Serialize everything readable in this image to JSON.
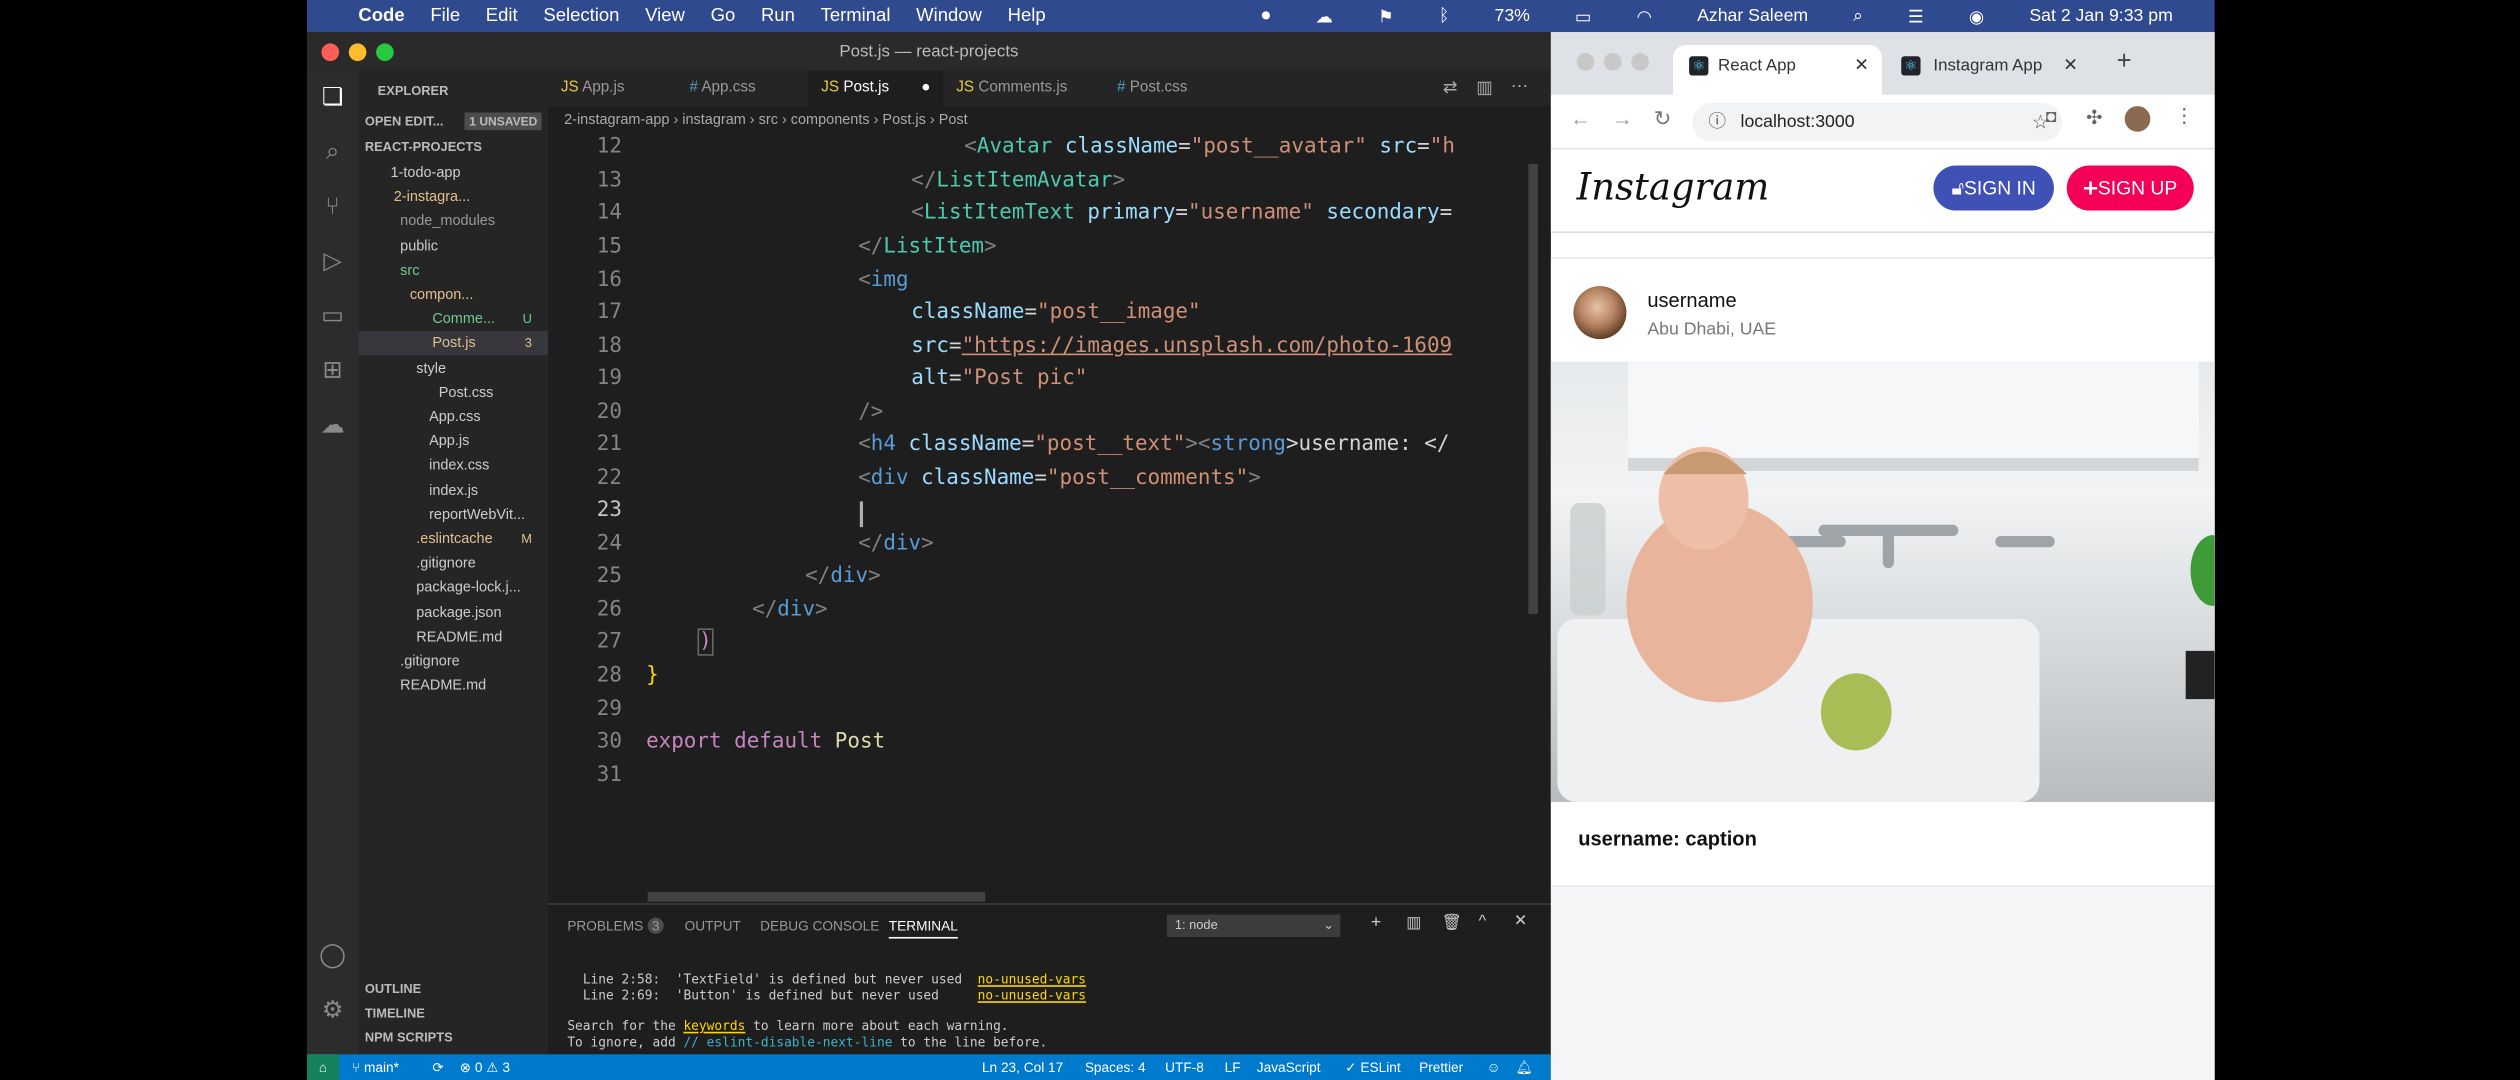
{
  "menubar": {
    "app": "Code",
    "items": [
      "File",
      "Edit",
      "Selection",
      "View",
      "Go",
      "Run",
      "Terminal",
      "Window",
      "Help"
    ],
    "battery": "73%",
    "user": "Azhar Saleem",
    "clock": "Sat 2 Jan  9:33 pm"
  },
  "vscode": {
    "title": "Post.js — react-projects",
    "tabs": [
      "App.js",
      "App.css",
      "Post.js",
      "Comments.js",
      "Post.css"
    ],
    "breadcrumb": "2-instagram-app › instagram › src › components › Post.js › Post",
    "explorer": {
      "header": "EXPLORER",
      "open_editors": "OPEN EDIT...",
      "unsaved": "1 UNSAVED",
      "project": "REACT-PROJECTS",
      "tree": [
        {
          "label": "1-todo-app",
          "badge": ""
        },
        {
          "label": "2-instagra...",
          "badge": ""
        },
        {
          "label": "node_modules",
          "badge": ""
        },
        {
          "label": "public",
          "badge": ""
        },
        {
          "label": "src",
          "badge": ""
        },
        {
          "label": "compon...",
          "badge": ""
        },
        {
          "label": "Comme...",
          "badge": "U"
        },
        {
          "label": "Post.js",
          "badge": "3"
        },
        {
          "label": "style",
          "badge": ""
        },
        {
          "label": "Post.css",
          "badge": ""
        },
        {
          "label": "App.css",
          "badge": ""
        },
        {
          "label": "App.js",
          "badge": ""
        },
        {
          "label": "index.css",
          "badge": ""
        },
        {
          "label": "index.js",
          "badge": ""
        },
        {
          "label": "reportWebVit...",
          "badge": ""
        },
        {
          "label": ".eslintcache",
          "badge": "M"
        },
        {
          "label": ".gitignore",
          "badge": ""
        },
        {
          "label": "package-lock.j...",
          "badge": ""
        },
        {
          "label": "package.json",
          "badge": ""
        },
        {
          "label": "README.md",
          "badge": ""
        },
        {
          "label": ".gitignore",
          "badge": ""
        },
        {
          "label": "README.md",
          "badge": ""
        }
      ],
      "outline": "OUTLINE",
      "timeline": "TIMELINE",
      "npm": "NPM SCRIPTS"
    },
    "line_numbers": [
      "12",
      "13",
      "14",
      "15",
      "16",
      "17",
      "18",
      "19",
      "20",
      "21",
      "22",
      "23",
      "24",
      "25",
      "26",
      "27",
      "28",
      "29",
      "30",
      "31"
    ],
    "code": {
      "l12a": "<",
      "l12b": "Avatar",
      "l12c": " className",
      "l12d": "=",
      "l12e": "\"post__avatar\"",
      "l12f": " src",
      "l12g": "=",
      "l12h": "\"h",
      "l13a": "</",
      "l13b": "ListItemAvatar",
      "l13c": ">",
      "l14a": "<",
      "l14b": "ListItemText",
      "l14c": " primary",
      "l14d": "=",
      "l14e": "\"username\"",
      "l14f": " secondary",
      "l14g": "=",
      "l15a": "</",
      "l15b": "ListItem",
      "l15c": ">",
      "l16a": "<",
      "l16b": "img",
      "l17a": "className",
      "l17b": "=",
      "l17c": "\"post__image\"",
      "l18a": "src",
      "l18b": "=",
      "l18c": "\"https://images.unsplash.com/photo-1609",
      "l19a": "alt",
      "l19b": "=",
      "l19c": "\"Post pic\"",
      "l20a": "/>",
      "l21a": "<",
      "l21b": "h4",
      "l21c": " className",
      "l21d": "=",
      "l21e": "\"post__text\"",
      "l21f": "><",
      "l21g": "strong",
      "l21h": ">username: </",
      "l22a": "<",
      "l22b": "div",
      "l22c": " className",
      "l22d": "=",
      "l22e": "\"post__comments\"",
      "l22f": ">",
      "l24a": "</",
      "l24b": "div",
      "l24c": ">",
      "l25a": "</",
      "l25b": "div",
      "l25c": ">",
      "l26a": "</",
      "l26b": "div",
      "l26c": ">",
      "l27a": ")",
      "l28a": "}",
      "l30a": "export",
      "l30b": " default",
      "l30c": " Post"
    },
    "panel": {
      "tabs": [
        "PROBLEMS",
        "OUTPUT",
        "DEBUG CONSOLE",
        "TERMINAL"
      ],
      "problems_count": "3",
      "terminal_select": "1: node",
      "lines": [
        {
          "pos": "Line 2:58:",
          "msg": "'TextField' is defined but never used",
          "rule": "no-unused-vars"
        },
        {
          "pos": "Line 2:69:",
          "msg": "'Button' is defined but never used",
          "rule": "no-unused-vars"
        }
      ],
      "search1": "Search for the ",
      "keywords": "keywords",
      "search2": " to learn more about each warning.",
      "ignore1": "To ignore, add ",
      "ignore2": "// eslint-disable-next-line",
      "ignore3": " to the line before."
    },
    "status": {
      "branch": "main*",
      "errors": "⊗ 0 ⚠ 3",
      "position": "Ln 23, Col 17",
      "spaces": "Spaces: 4",
      "encoding": "UTF-8",
      "eol": "LF",
      "language": "JavaScript",
      "eslint": "✓ ESLint",
      "prettier": "Prettier"
    }
  },
  "chrome": {
    "tabs": [
      "React App",
      "Instagram App"
    ],
    "url": "localhost:3000"
  },
  "instagram": {
    "logo": "Instagram",
    "sign_in": "SIGN IN",
    "sign_up": "SIGN UP",
    "username": "username",
    "location": "Abu Dhabi, UAE",
    "caption_user": "username:",
    "caption": " caption"
  },
  "colors": {
    "menubar": "#2f4a8f",
    "vscode_bg": "#1e1e1e",
    "statusbar": "#007acc",
    "sign_in": "#3f51b5",
    "sign_up": "#f50057"
  }
}
